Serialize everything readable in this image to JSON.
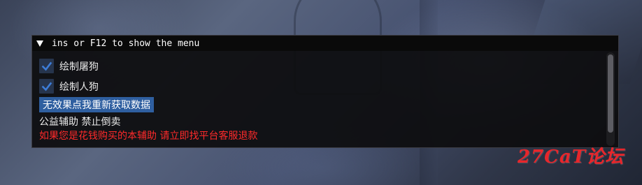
{
  "window": {
    "title": "ins or F12 to show the menu"
  },
  "checkboxes": [
    {
      "label": "绘制屠狗",
      "checked": true
    },
    {
      "label": "绘制人狗",
      "checked": true
    }
  ],
  "refresh_button": {
    "label": "无效果点我重新获取数据"
  },
  "notice_text": "公益辅助 禁止倒卖",
  "warning_text": "如果您是花钱购买的本辅助 请立即找平台客服退款",
  "watermark": "27CaT论坛",
  "colors": {
    "checkbox_bg": "#26344c",
    "checkmark": "#3d7cd6",
    "button_bg": "#2f5fa0",
    "warning": "#ff2a2a",
    "watermark": "#e8262b"
  }
}
